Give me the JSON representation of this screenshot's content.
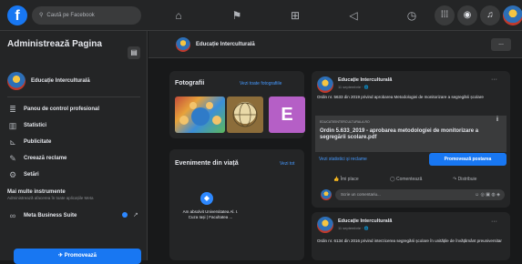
{
  "topbar": {
    "logo": "f",
    "search_placeholder": "Caută pe Facebook",
    "icons": [
      "home-icon",
      "flag-icon",
      "store-icon",
      "megaphone-icon",
      "clock-icon",
      "grid-icon",
      "messenger-icon",
      "bell-icon"
    ]
  },
  "sidebar": {
    "title": "Administrează Pagina",
    "page_name": "Educație Interculturală",
    "items": [
      {
        "label": "Panou de control profesional",
        "icon": "≣"
      },
      {
        "label": "Statistici",
        "icon": "▥"
      },
      {
        "label": "Publicitate",
        "icon": "⊾"
      },
      {
        "label": "Creează reclame",
        "icon": "✎"
      },
      {
        "label": "Setări",
        "icon": "⚙"
      }
    ],
    "more_tools": "Mai multe instrumente",
    "more_tools_sub": "Administrează afacerea în toate aplicațiile Meta",
    "meta_suite": "Meta Business Suite",
    "promote": "Promovează"
  },
  "page_header": {
    "name": "Educație Interculturală",
    "more": "..."
  },
  "photos_card": {
    "title": "Fotografii",
    "link": "Vezi toate fotografiile",
    "e_letter": "E"
  },
  "life_events": {
    "title": "Evenimente din viață",
    "link": "Vezi tot",
    "event_text": "Am absolvit Universitatea Al. I. Cuza Iași | Facultatea ..."
  },
  "post1": {
    "name": "Educație Interculturală",
    "date": "11 septembrie · 🌐",
    "text": "Ordin nr. 5633 din 2019 privind aprobarea Metodologiei de monitorizare a segregării școlare",
    "link_domain": "EDUCATIEINTERCULTURALA.RO",
    "link_title": "Ordin 5.633_2019 - aprobarea metodologiei de monitorizare a segregării scolare.pdf",
    "stats_link": "Vezi statistici și reclame",
    "boost": "Promovează postarea",
    "like": "Îmi place",
    "comment": "Comentează",
    "share": "Distribuie",
    "comment_placeholder": "Scrie un comentariu..."
  },
  "post2": {
    "name": "Educație Interculturală",
    "date": "11 septembrie · 🌐",
    "text": "Ordin nr. 6134 din 2016 privind interzicerea segregării școlare în unitățile de învățământ preuniversitar"
  },
  "colors": {
    "accent": "#1877f2",
    "background": "#18191a",
    "surface": "#242526"
  }
}
